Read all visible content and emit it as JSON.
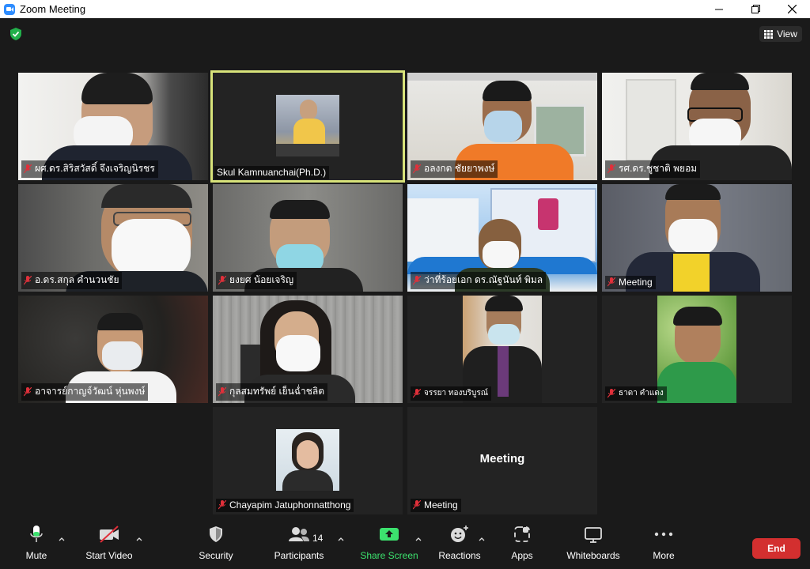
{
  "window": {
    "title": "Zoom Meeting"
  },
  "top_bar": {
    "view_label": "View"
  },
  "participants": [
    {
      "name": "ผศ.ดร.สิริสวัสดิ์ จึงเจริญนิรชร",
      "muted": true
    },
    {
      "name": "Skul Kamnuanchai(Ph.D.)",
      "muted": false,
      "active_speaker": true
    },
    {
      "name": "อลงกต ชัยยาพงษ์",
      "muted": true
    },
    {
      "name": "รศ.ดร.ชูชาติ พยอม",
      "muted": true
    },
    {
      "name": "อ.ดร.สกุล คำนวนชัย",
      "muted": true
    },
    {
      "name": "ยงยศ น้อยเจริญ",
      "muted": true
    },
    {
      "name": "ว่าที่ร้อยเอก ดร.ณัฐนันท์ พิมล",
      "muted": true
    },
    {
      "name": "Meeting",
      "muted": true
    },
    {
      "name": "อาจารย์กาญจ์วัฒน์ หุ่นพงษ์",
      "muted": true
    },
    {
      "name": "กุลสมทรัพย์ เย็นฉ่ำชลิต",
      "muted": true
    },
    {
      "name": "จรรยา ทองบริบูรณ์",
      "muted": true
    },
    {
      "name": "ธาดา คำแดง",
      "muted": true
    },
    {
      "name": "Chayapim Jatuphonnatthong",
      "muted": true
    },
    {
      "name": "Meeting",
      "muted": true,
      "video_off_label": "Meeting"
    }
  ],
  "toolbar": {
    "mute_label": "Mute",
    "start_video_label": "Start Video",
    "security_label": "Security",
    "participants_label": "Participants",
    "participants_count": "14",
    "share_screen_label": "Share Screen",
    "reactions_label": "Reactions",
    "apps_label": "Apps",
    "whiteboards_label": "Whiteboards",
    "more_label": "More",
    "end_label": "End"
  },
  "colors": {
    "accent_blue": "#2d8cff",
    "share_green": "#3ce26e",
    "end_red": "#d32f2f",
    "active_speaker_border": "#d8e37a",
    "muted_red": "#e0303a"
  }
}
